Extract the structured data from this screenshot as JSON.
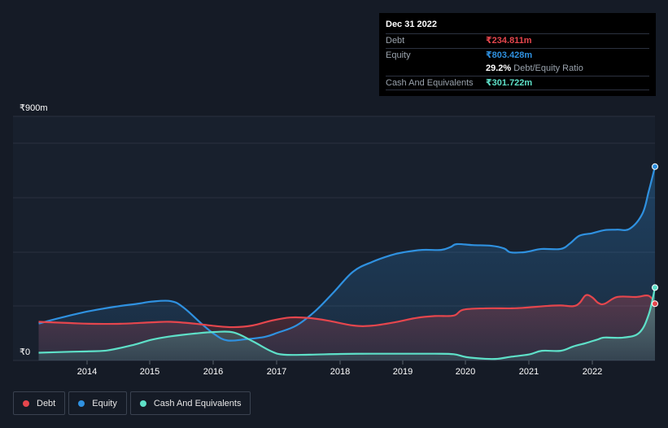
{
  "tooltip": {
    "date": "Dec 31 2022",
    "debt_label": "Debt",
    "debt_value": "₹234.811m",
    "equity_label": "Equity",
    "equity_value": "₹803.428m",
    "ratio_value": "29.2%",
    "ratio_label": "Debt/Equity Ratio",
    "cash_label": "Cash And Equivalents",
    "cash_value": "₹301.722m"
  },
  "legend": {
    "debt": "Debt",
    "equity": "Equity",
    "cash": "Cash And Equivalents"
  },
  "colors": {
    "debt": "#e5464d",
    "equity": "#2f91e0",
    "cash": "#5ee0c8",
    "background": "#151b26"
  },
  "chart_data": {
    "type": "area",
    "ylim": [
      0,
      900
    ],
    "y_tick_labels": [
      "₹0",
      "₹900m"
    ],
    "x_tick_labels": [
      "2014",
      "2015",
      "2016",
      "2017",
      "2018",
      "2019",
      "2020",
      "2021",
      "2022"
    ],
    "xlim": [
      2013.2,
      2023.0
    ],
    "series": [
      {
        "name": "Debt",
        "points": [
          [
            2013.2,
            160
          ],
          [
            2013.7,
            155
          ],
          [
            2014.0,
            152
          ],
          [
            2014.5,
            152
          ],
          [
            2015.0,
            158
          ],
          [
            2015.3,
            160
          ],
          [
            2015.7,
            152
          ],
          [
            2016.0,
            143
          ],
          [
            2016.3,
            138
          ],
          [
            2016.6,
            145
          ],
          [
            2016.9,
            165
          ],
          [
            2017.2,
            178
          ],
          [
            2017.5,
            176
          ],
          [
            2017.8,
            165
          ],
          [
            2018.2,
            145
          ],
          [
            2018.5,
            144
          ],
          [
            2018.9,
            160
          ],
          [
            2019.2,
            176
          ],
          [
            2019.5,
            184
          ],
          [
            2019.8,
            186
          ],
          [
            2019.95,
            210
          ],
          [
            2020.3,
            216
          ],
          [
            2020.7,
            216
          ],
          [
            2020.9,
            218
          ],
          [
            2021.3,
            226
          ],
          [
            2021.5,
            228
          ],
          [
            2021.7,
            225
          ],
          [
            2021.8,
            238
          ],
          [
            2021.9,
            270
          ],
          [
            2022.0,
            262
          ],
          [
            2022.1,
            238
          ],
          [
            2022.2,
            235
          ],
          [
            2022.4,
            263
          ],
          [
            2022.7,
            263
          ],
          [
            2022.9,
            268
          ],
          [
            2023.0,
            235
          ]
        ]
      },
      {
        "name": "Equity",
        "points": [
          [
            2013.2,
            153
          ],
          [
            2013.6,
            180
          ],
          [
            2014.0,
            204
          ],
          [
            2014.4,
            222
          ],
          [
            2014.8,
            236
          ],
          [
            2015.0,
            244
          ],
          [
            2015.3,
            246
          ],
          [
            2015.5,
            220
          ],
          [
            2015.8,
            150
          ],
          [
            2016.0,
            108
          ],
          [
            2016.2,
            83
          ],
          [
            2016.5,
            88
          ],
          [
            2016.8,
            98
          ],
          [
            2017.0,
            115
          ],
          [
            2017.3,
            145
          ],
          [
            2017.6,
            205
          ],
          [
            2017.9,
            285
          ],
          [
            2018.2,
            368
          ],
          [
            2018.5,
            408
          ],
          [
            2018.8,
            436
          ],
          [
            2019.0,
            448
          ],
          [
            2019.3,
            458
          ],
          [
            2019.6,
            458
          ],
          [
            2019.75,
            470
          ],
          [
            2019.85,
            482
          ],
          [
            2020.1,
            478
          ],
          [
            2020.4,
            475
          ],
          [
            2020.6,
            464
          ],
          [
            2020.7,
            448
          ],
          [
            2020.9,
            448
          ],
          [
            2021.0,
            452
          ],
          [
            2021.2,
            462
          ],
          [
            2021.5,
            462
          ],
          [
            2021.65,
            485
          ],
          [
            2021.8,
            517
          ],
          [
            2022.0,
            527
          ],
          [
            2022.2,
            540
          ],
          [
            2022.4,
            542
          ],
          [
            2022.6,
            546
          ],
          [
            2022.8,
            608
          ],
          [
            2022.9,
            700
          ],
          [
            2023.0,
            803
          ]
        ]
      },
      {
        "name": "Cash And Equivalents",
        "points": [
          [
            2013.2,
            32
          ],
          [
            2013.7,
            36
          ],
          [
            2014.0,
            38
          ],
          [
            2014.3,
            42
          ],
          [
            2014.7,
            64
          ],
          [
            2015.0,
            86
          ],
          [
            2015.3,
            100
          ],
          [
            2015.7,
            112
          ],
          [
            2016.0,
            118
          ],
          [
            2016.3,
            116
          ],
          [
            2016.6,
            80
          ],
          [
            2016.9,
            38
          ],
          [
            2017.1,
            24
          ],
          [
            2017.5,
            24
          ],
          [
            2018.0,
            27
          ],
          [
            2018.5,
            28
          ],
          [
            2019.0,
            28
          ],
          [
            2019.5,
            28
          ],
          [
            2019.8,
            26
          ],
          [
            2020.0,
            14
          ],
          [
            2020.3,
            7
          ],
          [
            2020.5,
            7
          ],
          [
            2020.7,
            15
          ],
          [
            2021.0,
            25
          ],
          [
            2021.2,
            40
          ],
          [
            2021.5,
            40
          ],
          [
            2021.7,
            58
          ],
          [
            2021.9,
            72
          ],
          [
            2022.1,
            88
          ],
          [
            2022.2,
            95
          ],
          [
            2022.5,
            95
          ],
          [
            2022.75,
            115
          ],
          [
            2022.9,
            190
          ],
          [
            2023.0,
            302
          ]
        ]
      }
    ]
  }
}
